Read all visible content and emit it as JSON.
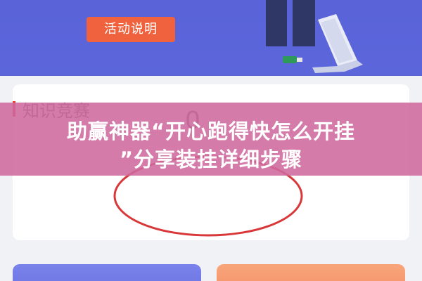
{
  "hero": {
    "activity_button_label": "活动说明"
  },
  "section": {
    "title": "知识竞赛"
  },
  "counter": {
    "value": "0"
  },
  "overlay_banner": {
    "line1": "助赢神器“开心跑得快怎么开挂",
    "line2": "”分享装挂详细步骤"
  },
  "colors": {
    "hero_background": "#5a63d8",
    "button": "#f0613d",
    "section_accent": "#e33b2e",
    "banner": "#ce699e",
    "highlight": "#d9383a"
  },
  "icons": [
    "laptop-icon",
    "usb-drive-icon"
  ]
}
